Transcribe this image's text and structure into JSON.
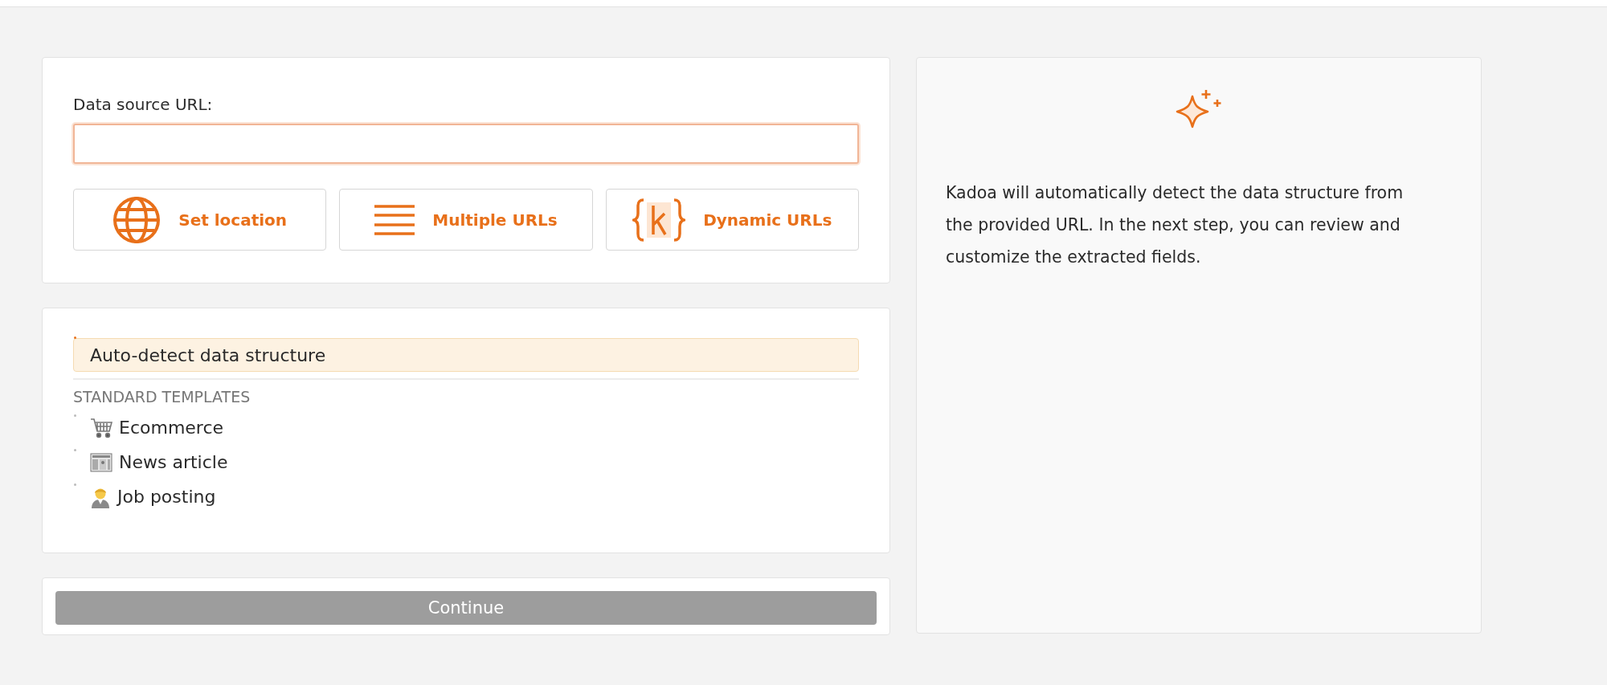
{
  "url_form": {
    "label": "Data source URL:",
    "buttons": [
      {
        "kind": "globe",
        "label": "Set location"
      },
      {
        "kind": "lines",
        "label": "Multiple URLs"
      },
      {
        "kind": "braces",
        "label": "Dynamic URLs"
      }
    ]
  },
  "structure": {
    "auto_detect": {
      "label": "Auto-detect data structure",
      "selected": true
    },
    "heading": "STANDARD TEMPLATES",
    "templates": [
      {
        "kind": "cart",
        "label": "Ecommerce",
        "selected": false
      },
      {
        "kind": "newspaper",
        "label": "News article",
        "selected": false
      },
      {
        "kind": "person",
        "label": "Job posting",
        "selected": false
      }
    ]
  },
  "continue_button": {
    "label": "Continue",
    "disabled": true
  },
  "info": {
    "text": "Kadoa will automatically detect the data structure from the provided URL. In the next step, you can review and customize the extracted fields."
  }
}
